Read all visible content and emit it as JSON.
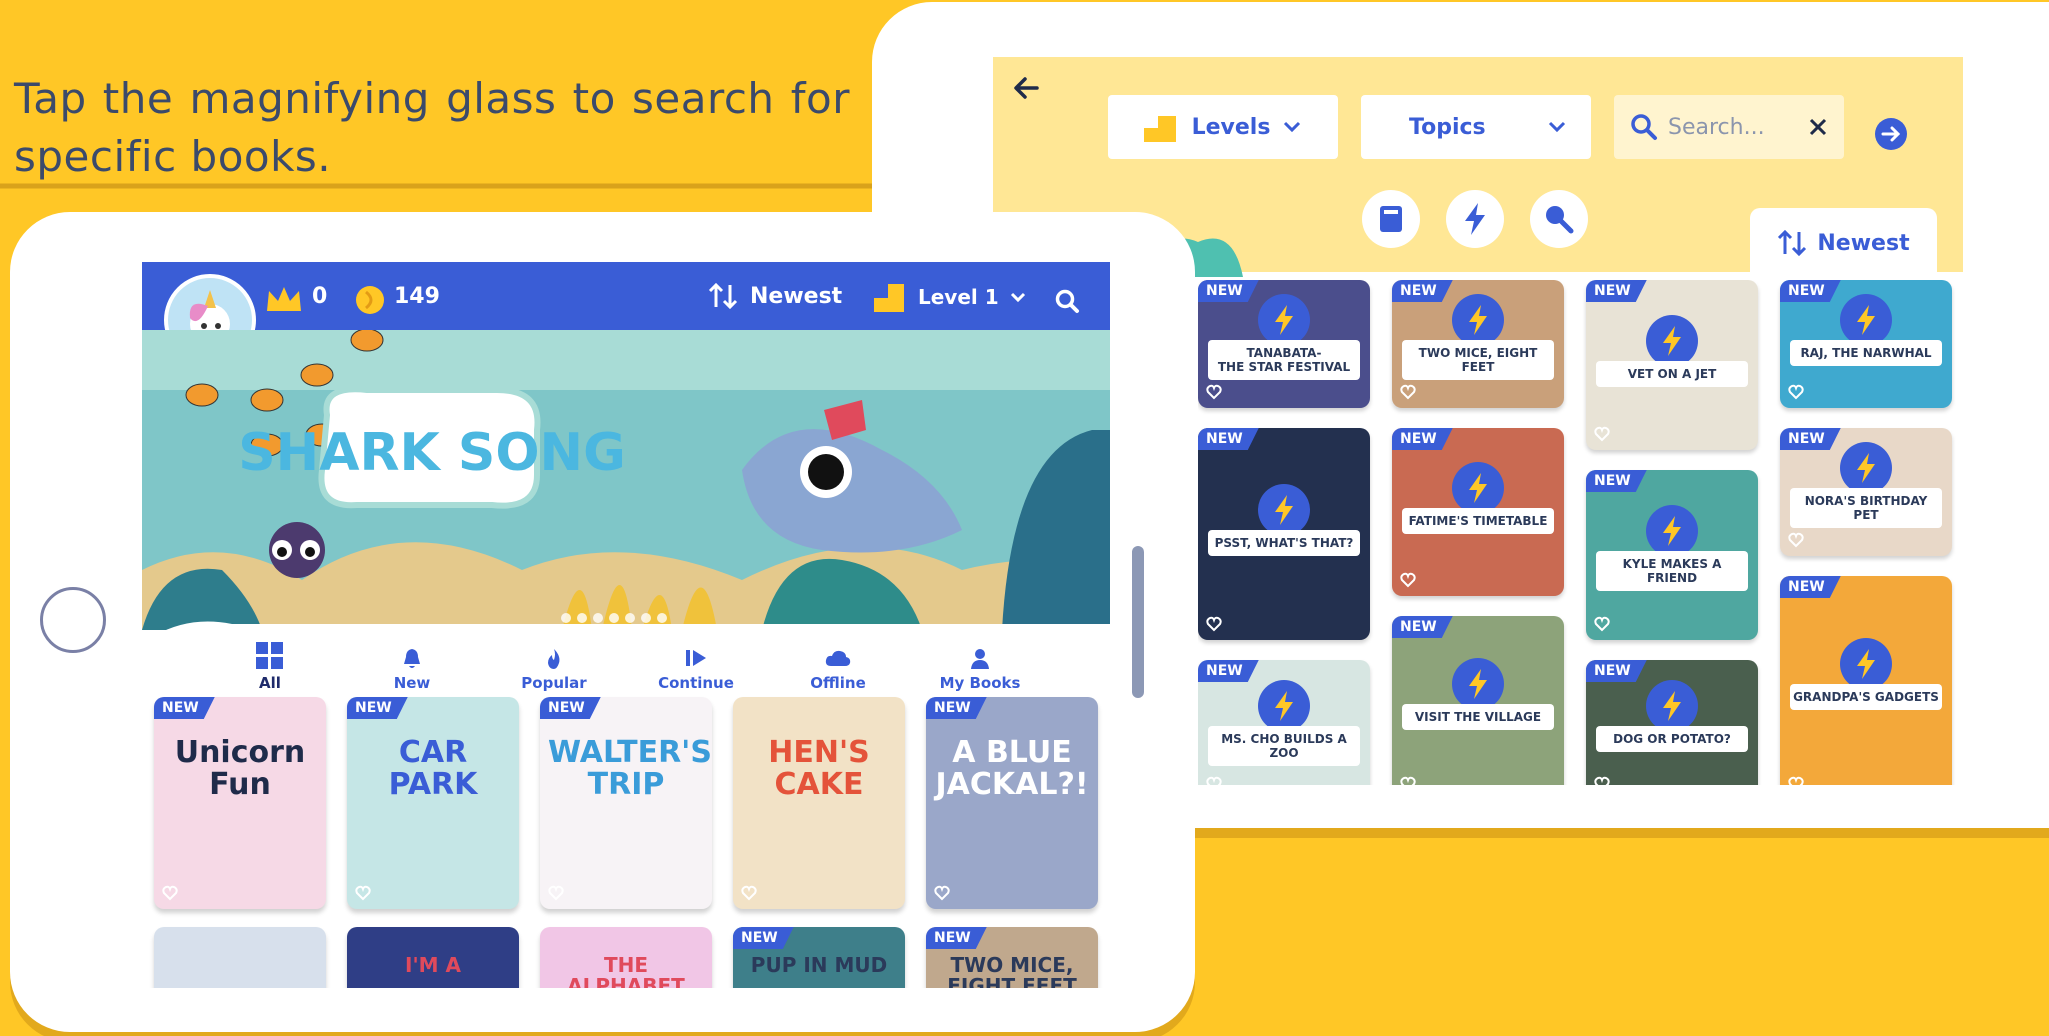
{
  "caption": "Tap the magnifying glass to search for specific books.",
  "search_screen": {
    "back_icon": "arrow-left-icon",
    "levels_label": "Levels",
    "topics_label": "Topics",
    "search_placeholder": "Search...",
    "sort_label": "Newest",
    "filter_icons": [
      "book-icon",
      "lightning-icon",
      "search-person-icon"
    ],
    "cards": [
      {
        "title": "TANABATA-\nTHE STAR FESTIVAL",
        "new": "NEW"
      },
      {
        "title": "TWO MICE, EIGHT FEET",
        "new": "NEW"
      },
      {
        "title": "VET ON A JET",
        "new": "NEW"
      },
      {
        "title": "RAJ, THE NARWHAL",
        "new": "NEW"
      },
      {
        "title": "PSST, WHAT'S THAT?",
        "new": "NEW"
      },
      {
        "title": "FATIME'S TIMETABLE",
        "new": "NEW"
      },
      {
        "title": "KYLE MAKES A FRIEND",
        "new": "NEW"
      },
      {
        "title": "NORA'S BIRTHDAY PET",
        "new": "NEW"
      },
      {
        "title": "MS. CHO BUILDS A ZOO",
        "new": "NEW"
      },
      {
        "title": "VISIT THE VILLAGE",
        "new": "NEW"
      },
      {
        "title": "DOG OR POTATO?",
        "new": "NEW"
      },
      {
        "title": "GRANDPA'S GADGETS",
        "new": "NEW"
      }
    ]
  },
  "home_screen": {
    "crowns": "0",
    "coins": "149",
    "sort_label": "Newest",
    "level_label": "Level 1",
    "hero_title": "SHARK SONG",
    "nav": [
      "All",
      "New",
      "Popular",
      "Continue",
      "Offline",
      "My Books"
    ],
    "books": [
      {
        "title": "Unicorn Fun",
        "new": "NEW"
      },
      {
        "title": "CAR PARK",
        "new": "NEW"
      },
      {
        "title": "WALTER'S TRIP",
        "new": "NEW"
      },
      {
        "title": "HEN'S CAKE",
        "new": ""
      },
      {
        "title": "A BLUE JACKAL?!",
        "new": "NEW"
      }
    ],
    "books_row2": [
      {
        "title": "",
        "new": ""
      },
      {
        "title": "I'M A",
        "new": ""
      },
      {
        "title": "THE ALPHABET",
        "new": ""
      },
      {
        "title": "PUP IN MUD",
        "new": "NEW"
      },
      {
        "title": "TWO MICE, EIGHT FEET",
        "new": "NEW"
      }
    ]
  },
  "colors": {
    "yellow": "#FFC726",
    "blue": "#3A5DD6",
    "header_yellow": "#FFE795"
  }
}
